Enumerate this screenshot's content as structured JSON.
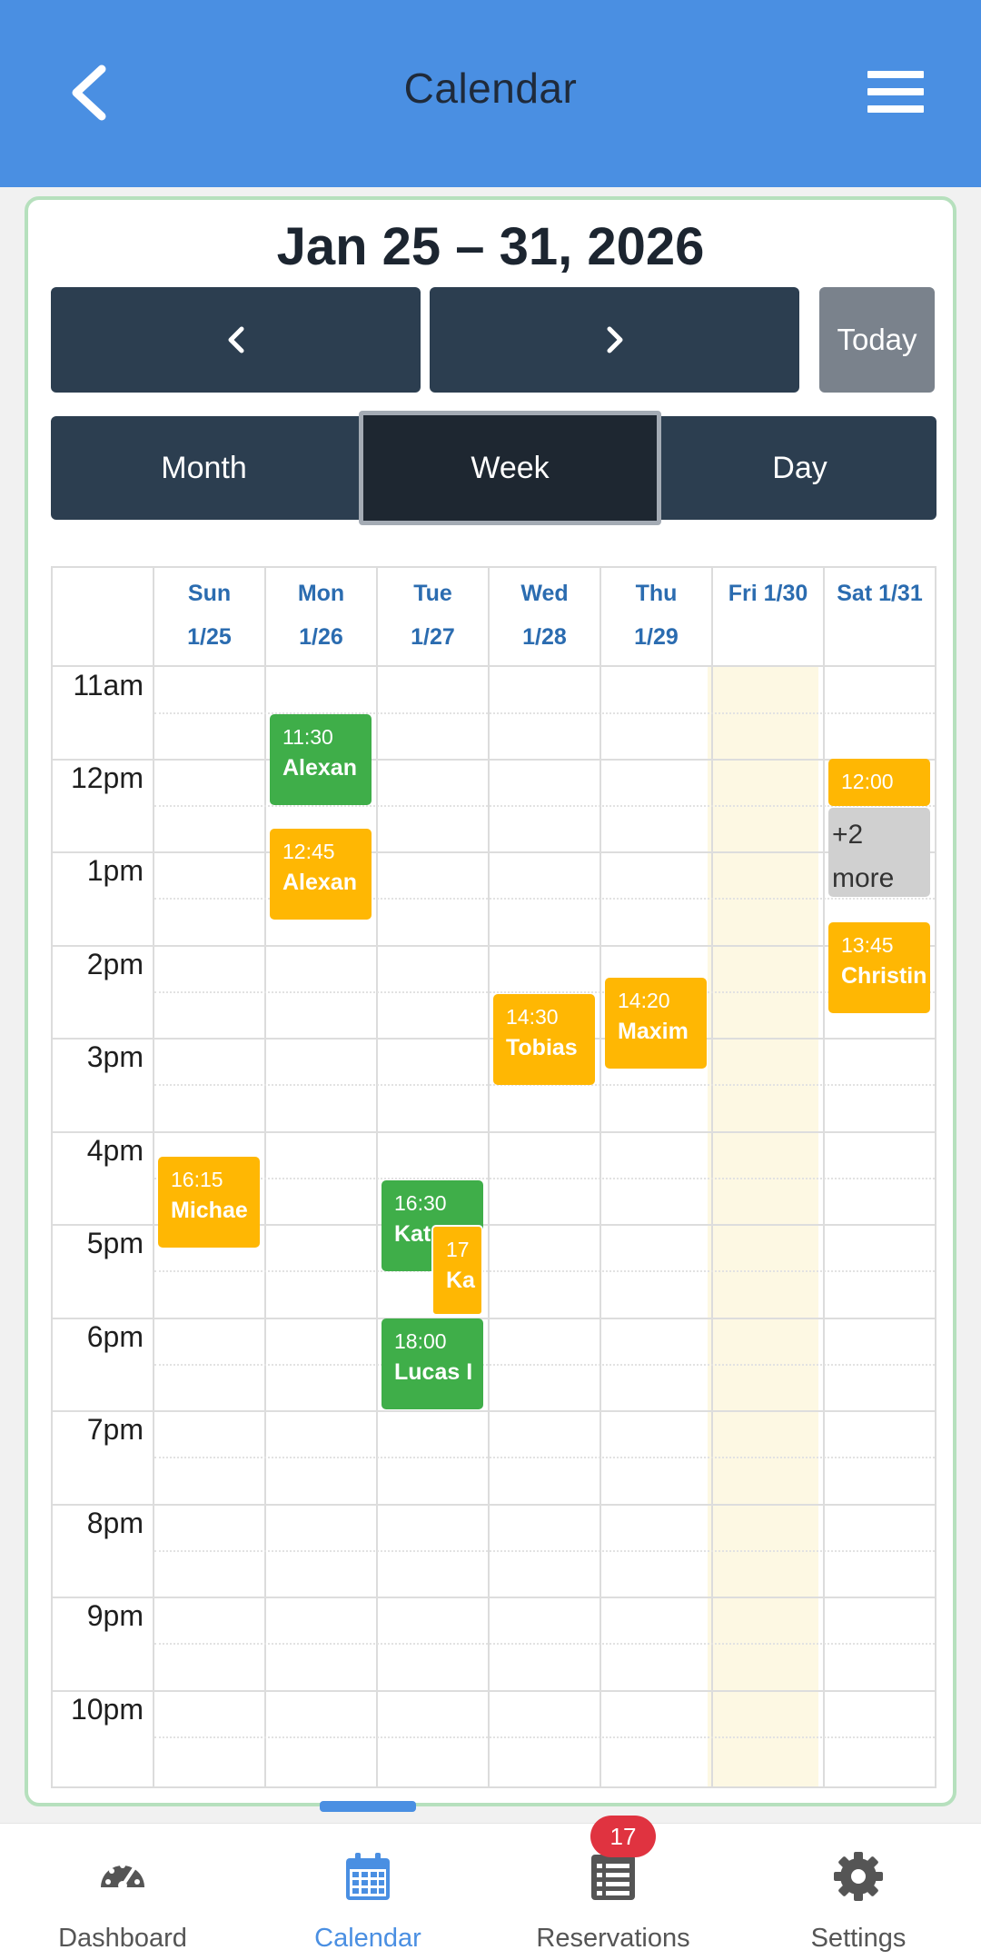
{
  "header": {
    "title": "Calendar",
    "back_icon": "chevron-left-icon",
    "menu_icon": "hamburger-menu-icon",
    "color": "#4a8fe2"
  },
  "range_title": "Jan 25 – 31, 2026",
  "nav_buttons": {
    "prev_icon": "chevron-left-icon",
    "next_icon": "chevron-right-icon",
    "today": "Today"
  },
  "views": {
    "month": "Month",
    "week": "Week",
    "day": "Day",
    "selected": "Week"
  },
  "days": [
    {
      "line1": "Sun",
      "line2": "1/25"
    },
    {
      "line1": "Mon",
      "line2": "1/26"
    },
    {
      "line1": "Tue",
      "line2": "1/27"
    },
    {
      "line1": "Wed",
      "line2": "1/28"
    },
    {
      "line1": "Thu",
      "line2": "1/29"
    },
    {
      "line1": "Fri 1/30",
      "line2": ""
    },
    {
      "line1": "Sat 1/31",
      "line2": ""
    }
  ],
  "today_day": "Fri 1/30",
  "hours": [
    "11am",
    "12pm",
    "1pm",
    "2pm",
    "3pm",
    "4pm",
    "5pm",
    "6pm",
    "7pm",
    "8pm",
    "9pm",
    "10pm"
  ],
  "events": {
    "mon_1130": {
      "time": "11:30",
      "name": "Alexan",
      "color": "#3fae49"
    },
    "mon_1245": {
      "time": "12:45",
      "name": "Alexan",
      "color": "#ffb703"
    },
    "wed_1430": {
      "time": "14:30",
      "name": "Tobias",
      "color": "#ffb703"
    },
    "thu_1420": {
      "time": "14:20",
      "name": "Maxim",
      "color": "#ffb703"
    },
    "sat_1200": {
      "time": "12:00",
      "name": "",
      "color": "#ffb703"
    },
    "sat_more": {
      "label": "+2 more"
    },
    "sat_1345": {
      "time": "13:45",
      "name": "Christin",
      "color": "#ffb703"
    },
    "sun_1615": {
      "time": "16:15",
      "name": "Michae",
      "color": "#ffb703"
    },
    "tue_1630": {
      "time": "16:30",
      "name": "Kat",
      "color": "#3fae49"
    },
    "tue_17": {
      "time": "17",
      "name": "Ka",
      "color": "#ffb703"
    },
    "tue_1800": {
      "time": "18:00",
      "name": "Lucas I",
      "color": "#3fae49"
    }
  },
  "bottom_nav": {
    "dashboard": {
      "label": "Dashboard",
      "icon": "speedometer-icon"
    },
    "calendar": {
      "label": "Calendar",
      "icon": "calendar-icon"
    },
    "reservations": {
      "label": "Reservations",
      "icon": "list-icon",
      "badge": "17"
    },
    "settings": {
      "label": "Settings",
      "icon": "gear-icon"
    },
    "active": "Calendar"
  }
}
